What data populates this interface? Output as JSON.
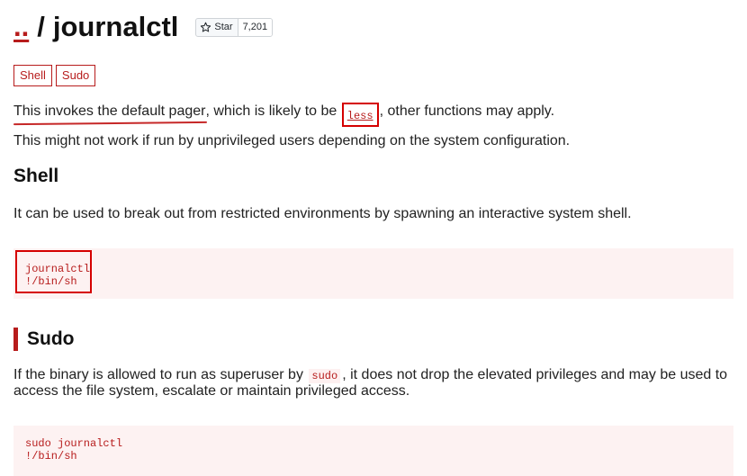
{
  "header": {
    "parent_link": "..",
    "separator": "/",
    "title": "journalctl",
    "star_label": "Star",
    "star_count": "7,201",
    "star_icon": "star-outline-icon"
  },
  "tags": [
    "Shell",
    "Sudo"
  ],
  "intro": {
    "p1_part1": "This invokes the default pager",
    "p1_part2": ", which is likely to be",
    "p1_code": "less",
    "p1_part3": ", other functions may apply.",
    "p2": "This might not work if run by unprivileged users depending on the system configuration."
  },
  "shell": {
    "heading": "Shell",
    "description": "It can be used to break out from restricted environments by spawning an interactive system shell.",
    "code_lines": [
      "journalctl",
      "!/bin/sh"
    ]
  },
  "sudo": {
    "heading": "Sudo",
    "desc_part1": "If the binary is allowed to run as superuser by",
    "desc_code": "sudo",
    "desc_part2": ", it does not drop the elevated privileges and may be used to",
    "desc_line2": "access the file system, escalate or maintain privileged access.",
    "code_lines": [
      "sudo journalctl",
      "!/bin/sh"
    ]
  },
  "colors": {
    "accent": "#b71c1c",
    "annotation_red": "#d50000",
    "code_bg": "#fdf2f2"
  }
}
